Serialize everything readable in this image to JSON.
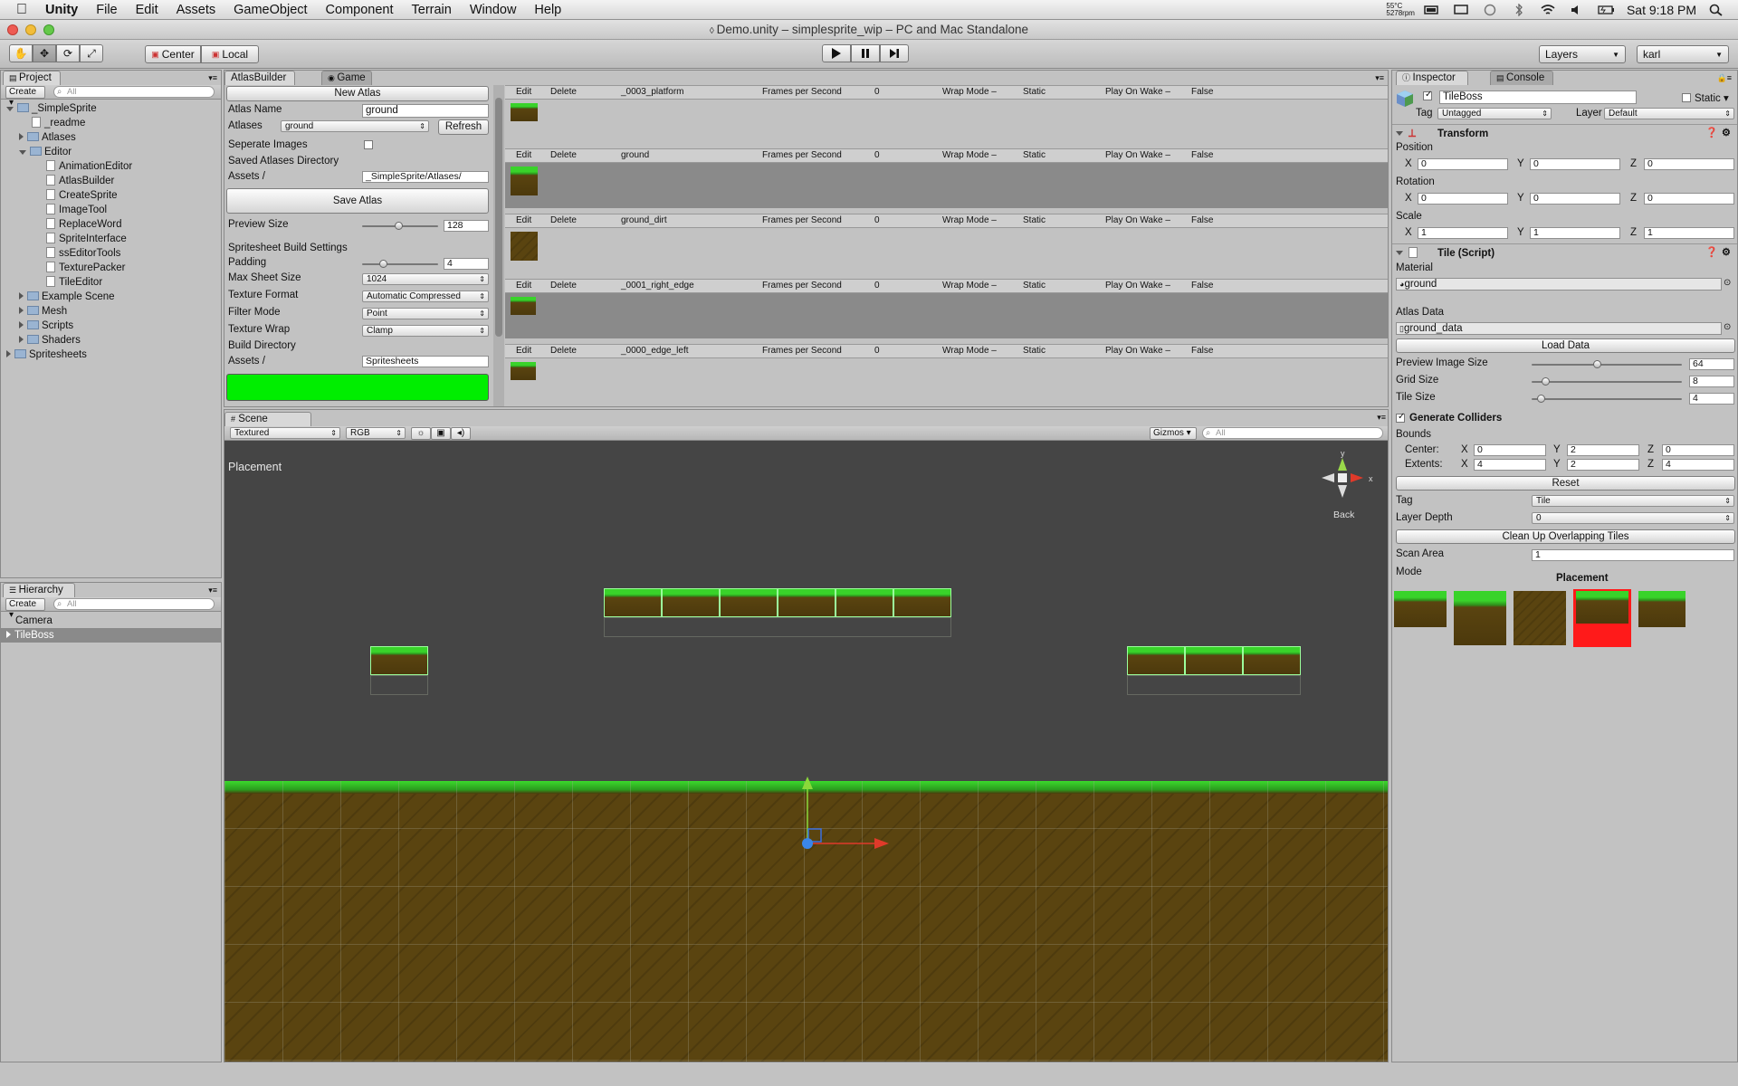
{
  "menubar": {
    "apple": "",
    "app": "Unity",
    "items": [
      "File",
      "Edit",
      "Assets",
      "GameObject",
      "Component",
      "Terrain",
      "Window",
      "Help"
    ],
    "temp": "55°C",
    "rpm": "5278rpm",
    "clock": "Sat 9:18 PM"
  },
  "window": {
    "title": "Demo.unity – simplesprite_wip – PC and Mac Standalone"
  },
  "toolbar": {
    "center": "Center",
    "local": "Local",
    "layers": "Layers",
    "layout": "karl"
  },
  "project": {
    "tab": "Project",
    "create": "Create",
    "search_placeholder": "All",
    "tree": [
      "_SimpleSprite",
      "_readme",
      "Atlases",
      "Editor",
      "AnimationEditor",
      "AtlasBuilder",
      "CreateSprite",
      "ImageTool",
      "ReplaceWord",
      "SpriteInterface",
      "ssEditorTools",
      "TexturePacker",
      "TileEditor",
      "Example Scene",
      "Mesh",
      "Scripts",
      "Shaders",
      "Spritesheets"
    ]
  },
  "hierarchy": {
    "tab": "Hierarchy",
    "create": "Create",
    "search_placeholder": "All",
    "items": [
      "Camera",
      "TileBoss"
    ]
  },
  "atlas": {
    "tab": "AtlasBuilder",
    "tab_game": "Game",
    "new_atlas": "New Atlas",
    "atlas_name_label": "Atlas Name",
    "atlas_name": "ground",
    "atlases_label": "Atlases",
    "atlases_value": "ground",
    "refresh": "Refresh",
    "separate_label": "Seperate Images",
    "saved_dir_label": "Saved Atlases Directory",
    "assets_label": "Assets /",
    "assets_value": "_SimpleSprite/Atlases/",
    "save_atlas": "Save Atlas",
    "preview_size_label": "Preview Size",
    "preview_size": "128",
    "preview_size_fraction": 0.48,
    "build_settings": "Spritesheet Build Settings",
    "padding_label": "Padding",
    "padding": "4",
    "padding_fraction": 0.25,
    "max_sheet_label": "Max Sheet Size",
    "max_sheet": "1024",
    "tex_format_label": "Texture Format",
    "tex_format": "Automatic Compressed",
    "filter_label": "Filter Mode",
    "filter": "Point",
    "wrap_label": "Texture Wrap",
    "wrap": "Clamp",
    "build_dir_label": "Build Directory",
    "build_assets_label": "Assets /",
    "build_assets_value": "Spritesheets"
  },
  "sheets": {
    "edit": "Edit",
    "delete": "Delete",
    "fps_label": "Frames per Second",
    "fps": "0",
    "wrap_label": "Wrap Mode –",
    "wrap": "Static",
    "play_label": "Play On Wake –",
    "play": "False",
    "names": [
      "_0003_platform",
      "ground",
      "ground_dirt",
      "_0001_right_edge",
      "_0000_edge_left"
    ]
  },
  "scene": {
    "tab": "Scene",
    "render_mode": "Textured",
    "color_mode": "RGB",
    "gizmos": "Gizmos",
    "search_placeholder": "All",
    "overlay": "Placement",
    "axis_y": "y",
    "axis_x": "x",
    "view_label": "Back"
  },
  "inspector": {
    "tab": "Inspector",
    "tab_console": "Console",
    "object_name": "TileBoss",
    "static": "Static",
    "tag_label": "Tag",
    "tag": "Untagged",
    "layer_label": "Layer",
    "layer": "Default",
    "transform": {
      "title": "Transform",
      "position_label": "Position",
      "rotation_label": "Rotation",
      "scale_label": "Scale",
      "x": "X",
      "y": "Y",
      "z": "Z",
      "position": [
        "0",
        "0",
        "0"
      ],
      "rotation": [
        "0",
        "0",
        "0"
      ],
      "scale": [
        "1",
        "1",
        "1"
      ]
    },
    "tile": {
      "title": "Tile (Script)",
      "material_label": "Material",
      "material": "ground",
      "atlas_data_label": "Atlas Data",
      "atlas_data": "ground_data",
      "load_data": "Load Data",
      "preview_label": "Preview Image Size",
      "preview": "64",
      "preview_fraction": 0.43,
      "grid_label": "Grid Size",
      "grid": "8",
      "grid_fraction": 0.07,
      "tile_label": "Tile Size",
      "tile": "4",
      "tile_fraction": 0.04,
      "gen_colliders": "Generate Colliders",
      "bounds_label": "Bounds",
      "center_label": "Center:",
      "extents_label": "Extents:",
      "center": [
        "0",
        "2",
        "0"
      ],
      "extents": [
        "4",
        "2",
        "4"
      ],
      "reset": "Reset",
      "tag2_label": "Tag",
      "tag2": "Tile",
      "layer_depth_label": "Layer Depth",
      "layer_depth": "0",
      "cleanup": "Clean Up Overlapping Tiles",
      "scan_label": "Scan Area",
      "scan": "1",
      "mode_label": "Mode",
      "mode": "Placement"
    }
  },
  "colors": {
    "accent_green": "#00ee00",
    "selected_red": "#ff1a1a",
    "scene_bg": "#454545"
  }
}
